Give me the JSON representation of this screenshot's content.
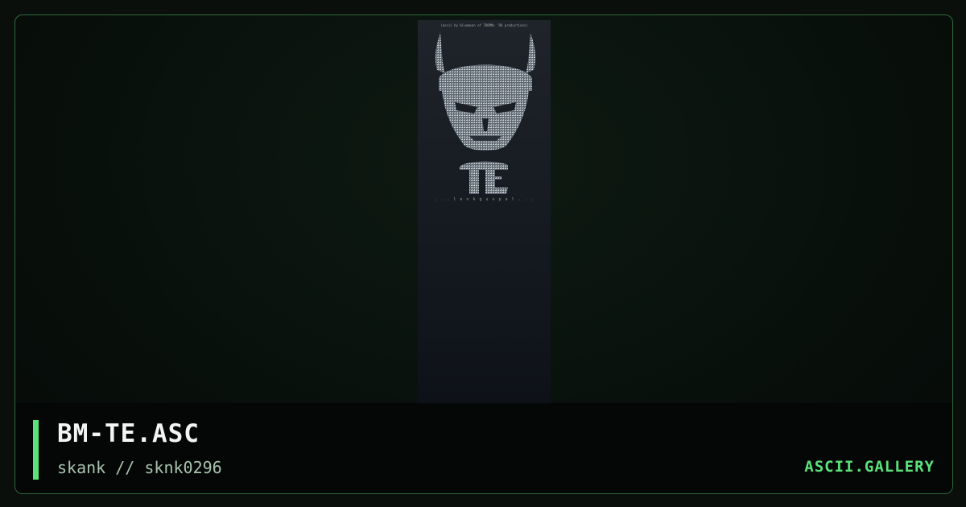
{
  "artwork": {
    "credit": "(ascii by bluemoon of 7BOMNs '96 productions)",
    "signature_dots": ". . . l e n k g u   o p a l . . ."
  },
  "caption": {
    "title": "BM-TE.ASC",
    "author": "skank // sknk0296",
    "site": "ASCII.GALLERY"
  },
  "colors": {
    "accent": "#5be37a",
    "frame_border": "#2f6b3a",
    "background": "#0b0f0c"
  }
}
